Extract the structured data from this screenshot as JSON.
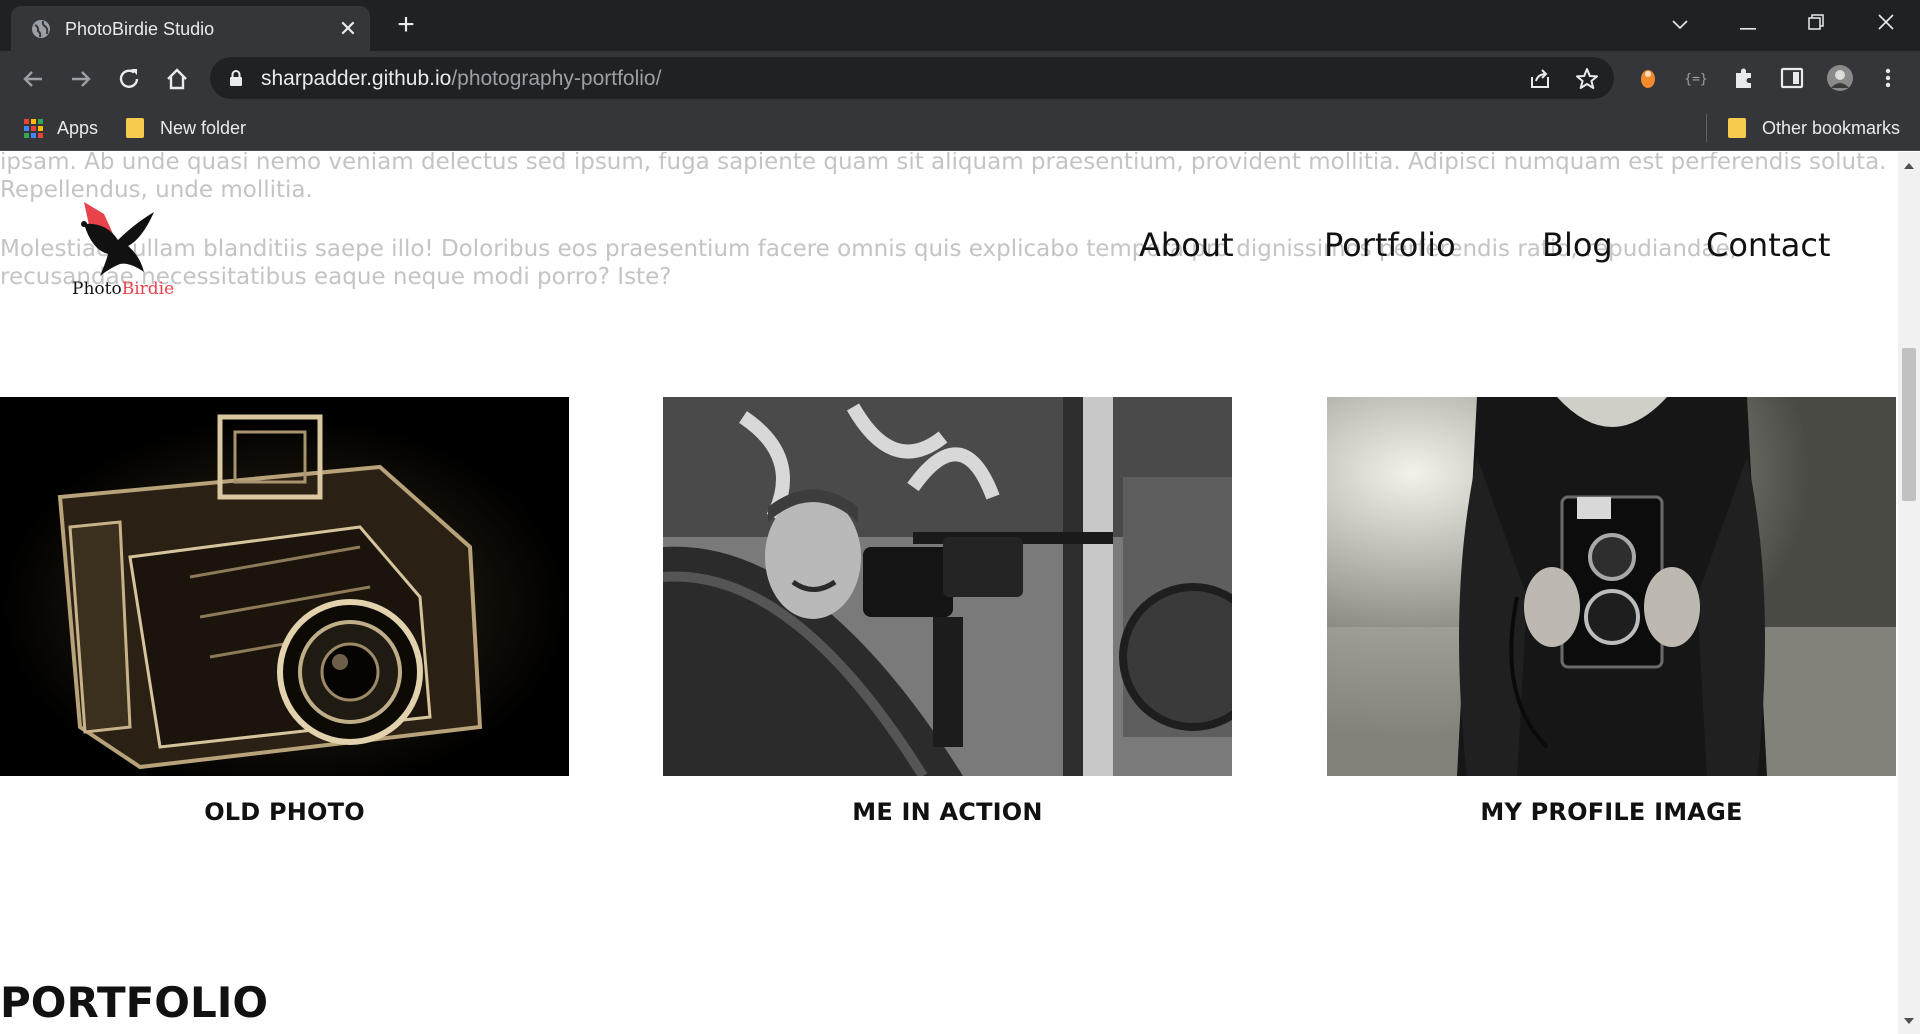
{
  "browser": {
    "tab_title": "PhotoBirdie Studio",
    "url_host": "sharpadder.github.io",
    "url_path": "/photography-portfolio/",
    "bookmarks": [
      {
        "label": "Apps",
        "icon": "apps-grid-icon"
      },
      {
        "label": "New folder",
        "icon": "folder-icon"
      }
    ],
    "other_bookmarks": "Other bookmarks"
  },
  "page": {
    "bg_lines": [
      "ipsam. Ab unde quasi nemo veniam delectus sed ipsum, fuga sapiente quam sit aliquam praesentium, provident mollitia. Adipisci numquam est perferendis soluta.",
      "Repellendus, unde mollitia.",
      "Molestiae nullam blanditiis saepe illo! Doloribus eos praesentium facere omnis quis explicabo tempora pro dignissimos perferendis ratio, repudiandae,",
      "recusandae necessitatibus eaque neque modi porro? Iste?"
    ],
    "logo": {
      "part1": "Photo",
      "part2": "Birdie"
    },
    "nav": [
      "About",
      "Portfolio",
      "Blog",
      "Contact"
    ],
    "cards": [
      {
        "caption": "OLD PHOTO"
      },
      {
        "caption": "ME IN ACTION"
      },
      {
        "caption": "MY PROFILE IMAGE"
      }
    ],
    "section_title": "PORTFOLIO"
  },
  "colors": {
    "accent_red": "#e8424a",
    "chrome_dark": "#202124",
    "chrome_mid": "#35363a"
  }
}
